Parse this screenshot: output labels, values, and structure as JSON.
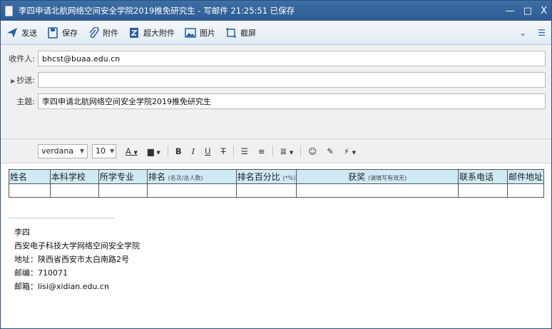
{
  "window": {
    "title": "李四申请北航网络空间安全学院2019推免研究生 - 写邮件   21:25:51 已保存",
    "controls": [
      "—",
      "□",
      "X"
    ]
  },
  "toolbar": {
    "send": "发送",
    "save": "保存",
    "attach": "附件",
    "big_attach": "超大附件",
    "image": "图片",
    "screenshot": "截屏"
  },
  "fields": {
    "to_label": "收件人:",
    "to_value": "bhcst@buaa.edu.cn",
    "cc_label": "抄送:",
    "cc_value": "",
    "subject_label": "主题:",
    "subject_value": "李四申请北航网络空间安全学院2019推免研究生"
  },
  "format": {
    "font": "verdana",
    "size": "10"
  },
  "table": {
    "headers": [
      {
        "main": "姓名",
        "sub": ""
      },
      {
        "main": "本科学校",
        "sub": ""
      },
      {
        "main": "所学专业",
        "sub": ""
      },
      {
        "main": "排名",
        "sub": "(名次/总人数)"
      },
      {
        "main": "排名百分比",
        "sub": "(*%)"
      },
      {
        "main": "获奖",
        "sub": "(请填写有效无)"
      },
      {
        "main": "联系电话",
        "sub": ""
      },
      {
        "main": "邮件地址",
        "sub": ""
      }
    ]
  },
  "signature": {
    "name": "李四",
    "school": "西安电子科技大学网络空间安全学院",
    "address": "地址：陕西省西安市太白南路2号",
    "postcode": "邮编：710071",
    "email": "邮箱：lisi@xidian.edu.cn"
  }
}
